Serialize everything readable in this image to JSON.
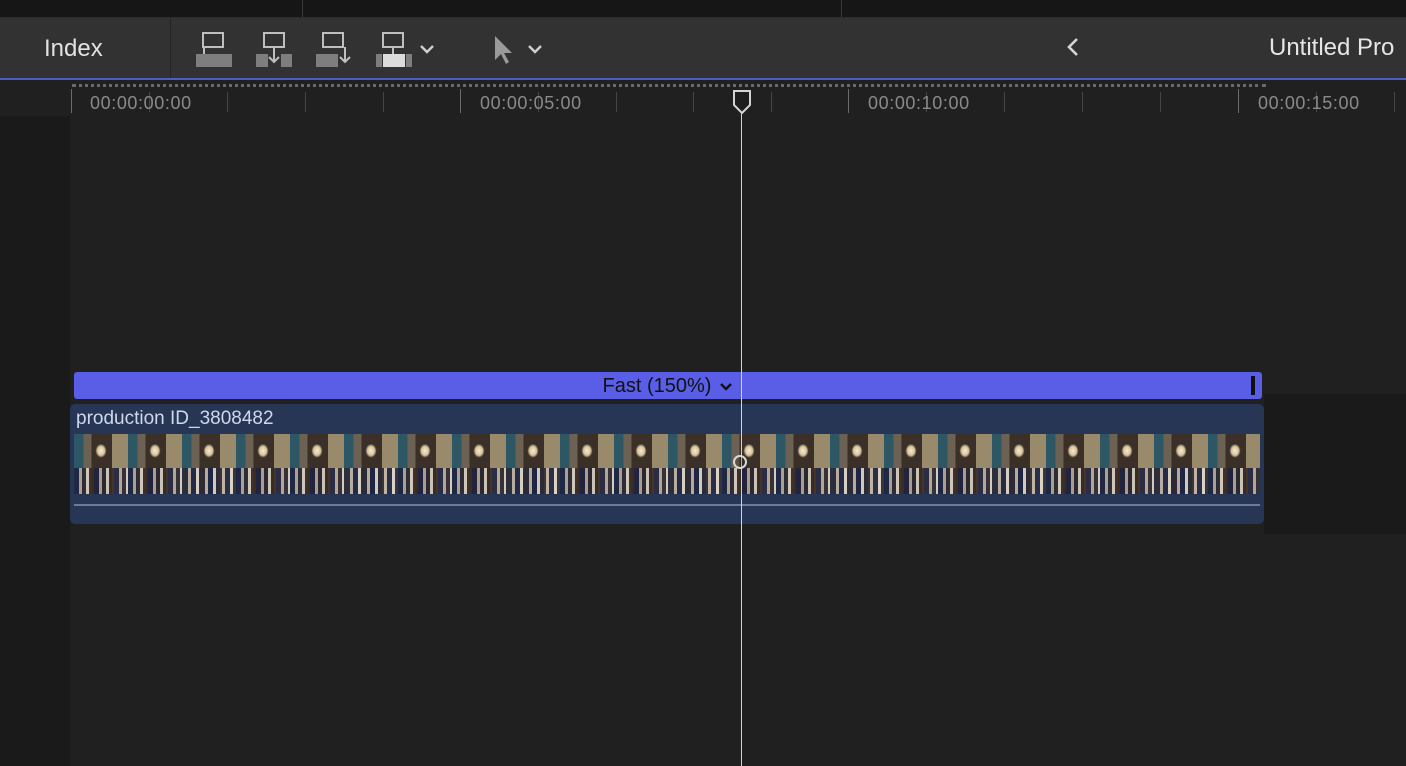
{
  "toolbar": {
    "index_label": "Index",
    "title_label": "Untitled Pro",
    "buttons": [
      {
        "icon": "connect-clip-icon"
      },
      {
        "icon": "insert-clip-icon"
      },
      {
        "icon": "append-clip-icon"
      },
      {
        "icon": "overwrite-clip-icon"
      },
      {
        "icon": "select-tool-icon"
      }
    ]
  },
  "ruler": {
    "timecodes": [
      "00:00:00:00",
      "00:00:05:00",
      "00:00:10:00",
      "00:00:15:00"
    ]
  },
  "retime": {
    "label": "Fast (150%)"
  },
  "clip": {
    "name": "production ID_3808482"
  },
  "colors": {
    "toolbar_bg": "#323232",
    "timeline_bg": "#202020",
    "retime_bar": "#5a5ee6",
    "clip_bg": "#263654",
    "playhead": "#d4d4d4"
  }
}
